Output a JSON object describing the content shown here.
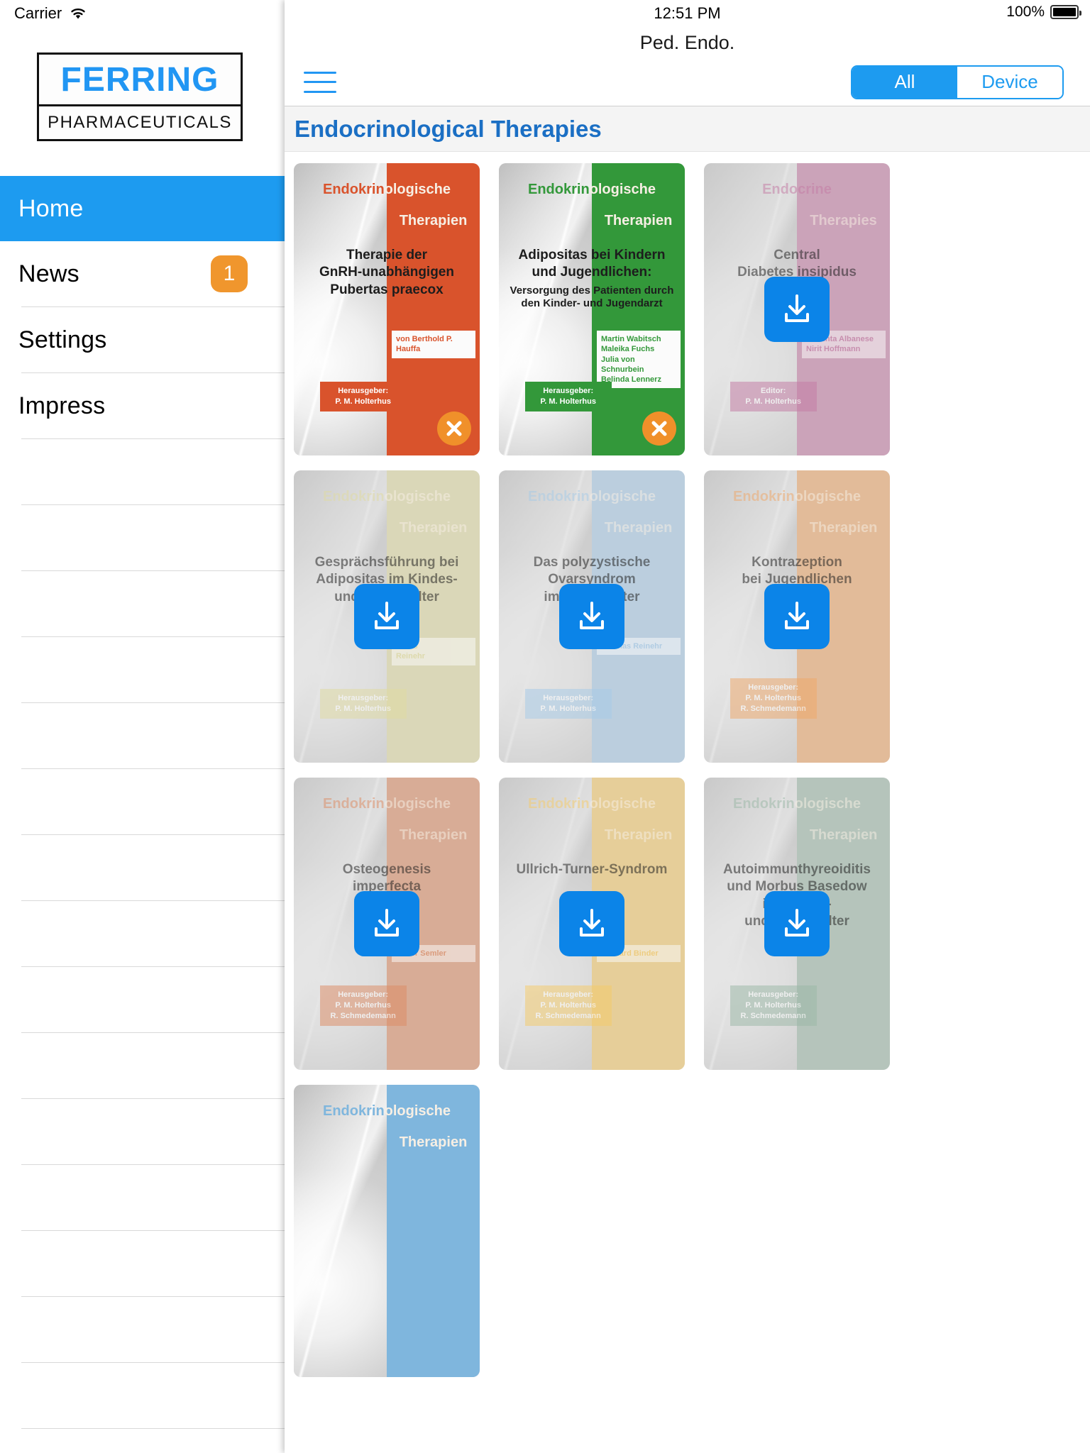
{
  "status_bar": {
    "carrier": "Carrier",
    "wifi_icon": "wifi-icon",
    "time": "12:51 PM",
    "battery_percent": "100%",
    "battery_icon": "battery-full-icon"
  },
  "sidebar": {
    "logo": {
      "name": "FERRING",
      "tagline": "PHARMACEUTICALS"
    },
    "items": [
      {
        "label": "Home",
        "active": true,
        "badge": ""
      },
      {
        "label": "News",
        "active": false,
        "badge": "1"
      },
      {
        "label": "Settings",
        "active": false,
        "badge": ""
      },
      {
        "label": "Impress",
        "active": false,
        "badge": ""
      }
    ]
  },
  "main": {
    "nav_title": "Ped. Endo.",
    "menu_icon": "hamburger-menu-icon",
    "segmented": {
      "options": [
        "All",
        "Device"
      ],
      "selected": "All"
    },
    "section_title": "Endocrinological Therapies",
    "accent_blue": "#1d9bf0",
    "badge_orange": "#f0962d",
    "download_blue": "#0b84e8"
  },
  "cards": [
    {
      "brand_1": "Endokrin",
      "brand_2": "ologische",
      "brand_3": "Therapien",
      "title": "Therapie der\nGnRH-unabhängigen\nPubertas praecox",
      "subtitle": "",
      "authors": "von Berthold P. Hauffa",
      "editor_label": "Herausgeber:",
      "editor_name": "P. M. Holterhus",
      "color": "#d9532c",
      "state": "downloaded",
      "action_icon": "close-circle-icon"
    },
    {
      "brand_1": "Endokrin",
      "brand_2": "ologische",
      "brand_3": "Therapien",
      "title": "Adipositas bei Kindern\nund Jugendlichen:",
      "subtitle": "Versorgung des Patienten durch\nden Kinder- und Jugendarzt",
      "authors": "Martin Wabitsch\nMaleika Fuchs\nJulia von Schnurbein\nBelinda Lennerz",
      "editor_label": "Herausgeber:",
      "editor_name": "P. M. Holterhus",
      "color": "#33983a",
      "state": "downloaded",
      "action_icon": "close-circle-icon"
    },
    {
      "brand_1": "Endocrine",
      "brand_2": "",
      "brand_3": "Therapies",
      "title": "Central\nDiabetes insipidus",
      "subtitle": "",
      "authors": "Assunta Albanese\nNirit Hoffmann",
      "editor_label": "Editor:",
      "editor_name": "P. M. Holterhus",
      "color": "#c47ba4",
      "state": "downloadable",
      "action_icon": "download-icon"
    },
    {
      "brand_1": "Endokrin",
      "brand_2": "ologische",
      "brand_3": "Therapien",
      "title": "Gesprächsführung bei\nAdipositas im Kindes-\nund Jugendalter",
      "subtitle": "",
      "authors": "Dieris\nReinehr",
      "editor_label": "Herausgeber:",
      "editor_name": "P. M. Holterhus",
      "color": "#e0dba2",
      "state": "downloadable",
      "action_icon": "download-icon"
    },
    {
      "brand_1": "Endokrin",
      "brand_2": "ologische",
      "brand_3": "Therapien",
      "title": "Das polyzystische\nOvarsyndrom\nim Jugendalter",
      "subtitle": "",
      "authors": "Thomas Reinehr",
      "editor_label": "Herausgeber:",
      "editor_name": "P. M. Holterhus",
      "color": "#a7cbe8",
      "state": "downloadable",
      "action_icon": "download-icon"
    },
    {
      "brand_1": "Endokrin",
      "brand_2": "ologische",
      "brand_3": "Therapien",
      "title": "Kontrazeption\nbei Jugendlichen",
      "subtitle": "",
      "authors": "",
      "editor_label": "Herausgeber:",
      "editor_name": "P. M. Holterhus\nR. Schmedemann",
      "color": "#efa86a",
      "state": "downloadable",
      "action_icon": "download-icon"
    },
    {
      "brand_1": "Endokrin",
      "brand_2": "ologische",
      "brand_3": "Therapien",
      "title": "Osteogenesis\nimperfecta",
      "subtitle": "",
      "authors": "Oliver Semler",
      "editor_label": "Herausgeber:",
      "editor_name": "P. M. Holterhus\nR. Schmedemann",
      "color": "#dd8c65",
      "state": "downloadable",
      "action_icon": "download-icon"
    },
    {
      "brand_1": "Endokrin",
      "brand_2": "ologische",
      "brand_3": "Therapien",
      "title": "Ullrich-Turner-Syndrom",
      "subtitle": "",
      "authors": "Gerhard Binder",
      "editor_label": "Herausgeber:",
      "editor_name": "P. M. Holterhus\nR. Schmedemann",
      "color": "#f5cb6a",
      "state": "downloadable",
      "action_icon": "download-icon"
    },
    {
      "brand_1": "Endokrin",
      "brand_2": "ologische",
      "brand_3": "Therapien",
      "title": "Autoimmunthyreoiditis\nund Morbus Basedow\nim Kindes-\nund Jugendalter",
      "subtitle": "",
      "authors": "",
      "editor_label": "Herausgeber:",
      "editor_name": "P. M. Holterhus\nR. Schmedemann",
      "color": "#9cb8a7",
      "state": "downloadable",
      "action_icon": "download-icon"
    },
    {
      "brand_1": "Endokrin",
      "brand_2": "ologische",
      "brand_3": "Therapien",
      "title": "",
      "subtitle": "",
      "authors": "",
      "editor_label": "",
      "editor_name": "",
      "color": "#7fb6dd",
      "state": "partial",
      "action_icon": ""
    }
  ]
}
